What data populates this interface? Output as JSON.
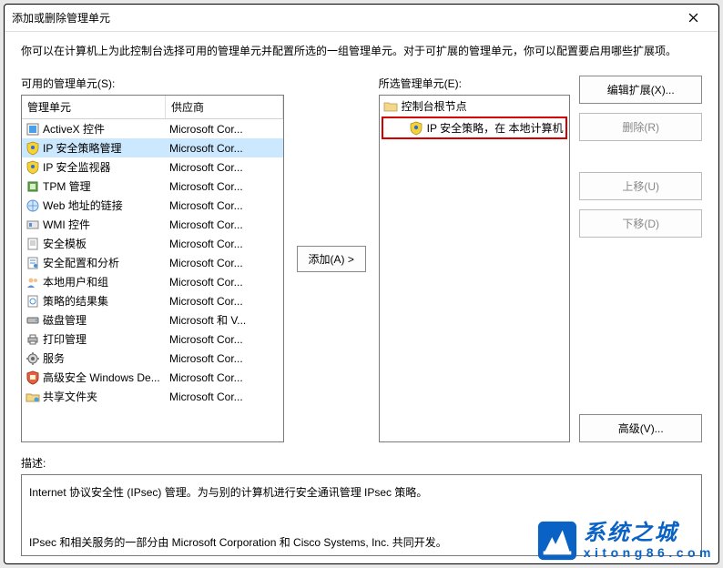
{
  "dialog": {
    "title": "添加或删除管理单元",
    "intro": "你可以在计算机上为此控制台选择可用的管理单元并配置所选的一组管理单元。对于可扩展的管理单元，你可以配置要启用哪些扩展项。"
  },
  "left": {
    "label": "可用的管理单元(S):",
    "headers": {
      "name": "管理单元",
      "vendor": "供应商"
    },
    "items": [
      {
        "name": "ActiveX 控件",
        "vendor": "Microsoft Cor...",
        "icon": "activex"
      },
      {
        "name": "IP 安全策略管理",
        "vendor": "Microsoft Cor...",
        "icon": "shield-y",
        "selected": true
      },
      {
        "name": "IP 安全监视器",
        "vendor": "Microsoft Cor...",
        "icon": "shield-y"
      },
      {
        "name": "TPM 管理",
        "vendor": "Microsoft Cor...",
        "icon": "tpm"
      },
      {
        "name": "Web 地址的链接",
        "vendor": "Microsoft Cor...",
        "icon": "link"
      },
      {
        "name": "WMI 控件",
        "vendor": "Microsoft Cor...",
        "icon": "wmi"
      },
      {
        "name": "安全模板",
        "vendor": "Microsoft Cor...",
        "icon": "template"
      },
      {
        "name": "安全配置和分析",
        "vendor": "Microsoft Cor...",
        "icon": "config"
      },
      {
        "name": "本地用户和组",
        "vendor": "Microsoft Cor...",
        "icon": "users"
      },
      {
        "name": "策略的结果集",
        "vendor": "Microsoft Cor...",
        "icon": "policy"
      },
      {
        "name": "磁盘管理",
        "vendor": "Microsoft 和 V...",
        "icon": "disk"
      },
      {
        "name": "打印管理",
        "vendor": "Microsoft Cor...",
        "icon": "print"
      },
      {
        "name": "服务",
        "vendor": "Microsoft Cor...",
        "icon": "service"
      },
      {
        "name": "高级安全 Windows De...",
        "vendor": "Microsoft Cor...",
        "icon": "firewall"
      },
      {
        "name": "共享文件夹",
        "vendor": "Microsoft Cor...",
        "icon": "share"
      }
    ]
  },
  "center": {
    "add_label": "添加(A) >"
  },
  "right": {
    "label": "所选管理单元(E):",
    "root": "控制台根节点",
    "child": "IP 安全策略，在 本地计算机"
  },
  "buttons": {
    "edit_ext": "编辑扩展(X)...",
    "remove": "删除(R)",
    "move_up": "上移(U)",
    "move_down": "下移(D)",
    "advanced": "高级(V)..."
  },
  "desc": {
    "label": "描述:",
    "line1": "Internet 协议安全性 (IPsec) 管理。为与别的计算机进行安全通讯管理 IPsec 策略。",
    "line2": "IPsec 和相关服务的一部分由 Microsoft Corporation 和 Cisco Systems, Inc. 共同开发。"
  },
  "watermark": {
    "zh": "系统之城",
    "en": "xitong86.com"
  }
}
